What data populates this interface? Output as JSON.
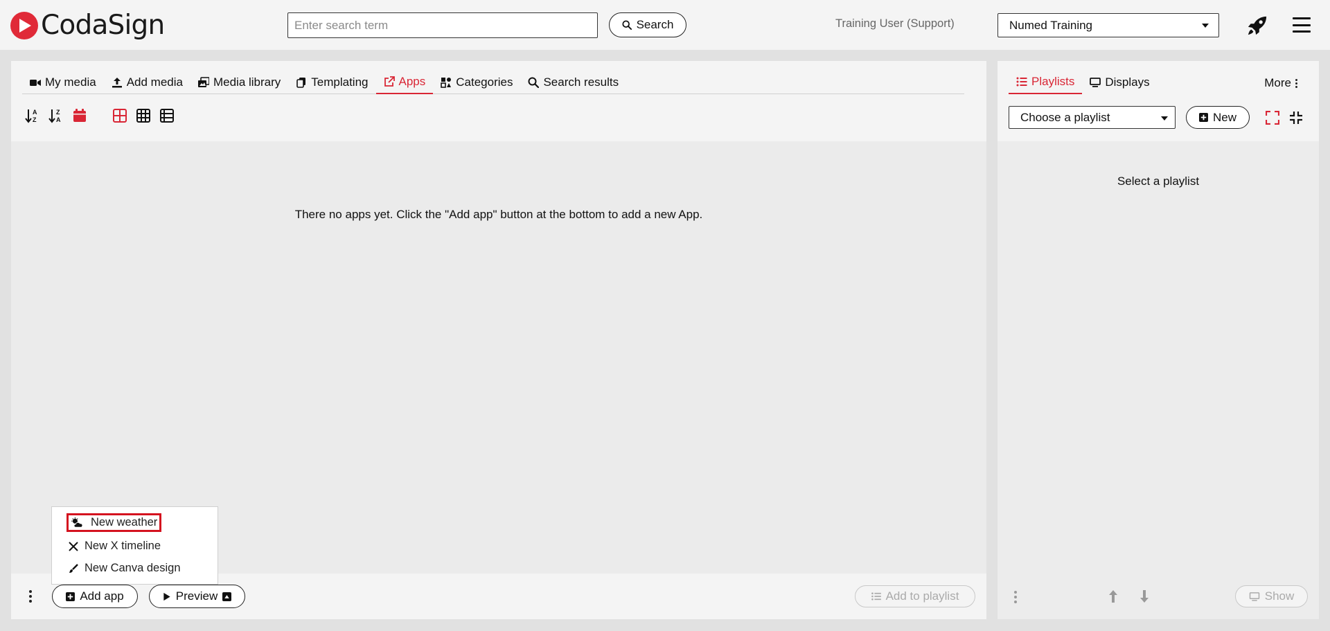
{
  "header": {
    "brand": "CodaSign",
    "search_placeholder": "Enter search term",
    "search_button": "Search",
    "user": "Training User (Support)",
    "organization": "Numed Training"
  },
  "main": {
    "tabs": [
      {
        "label": "My media",
        "icon": "video-camera-icon"
      },
      {
        "label": "Add media",
        "icon": "upload-icon"
      },
      {
        "label": "Media library",
        "icon": "images-icon"
      },
      {
        "label": "Templating",
        "icon": "copy-icon"
      },
      {
        "label": "Apps",
        "icon": "external-link-icon",
        "active": true
      },
      {
        "label": "Categories",
        "icon": "categories-icon"
      },
      {
        "label": "Search results",
        "icon": "search-icon"
      }
    ],
    "empty_message": "There no apps yet. Click the \"Add app\" button at the bottom to add a new App.",
    "add_app_button": "Add app",
    "preview_button": "Preview",
    "add_to_playlist_button": "Add to playlist",
    "add_app_menu": [
      {
        "label": "New weather",
        "icon": "cloud-sun-icon",
        "highlighted": true
      },
      {
        "label": "New X timeline",
        "icon": "x-logo-icon"
      },
      {
        "label": "New Canva design",
        "icon": "paintbrush-icon"
      }
    ]
  },
  "side": {
    "tabs": [
      {
        "label": "Playlists",
        "icon": "list-icon",
        "active": true
      },
      {
        "label": "Displays",
        "icon": "monitor-icon"
      }
    ],
    "more_label": "More",
    "playlist_select": "Choose a playlist",
    "new_button": "New",
    "empty_message": "Select a playlist",
    "show_button": "Show"
  },
  "colors": {
    "accent": "#d92635",
    "header_bg": "#f4f4f4",
    "page_bg": "#e1e1e1"
  }
}
